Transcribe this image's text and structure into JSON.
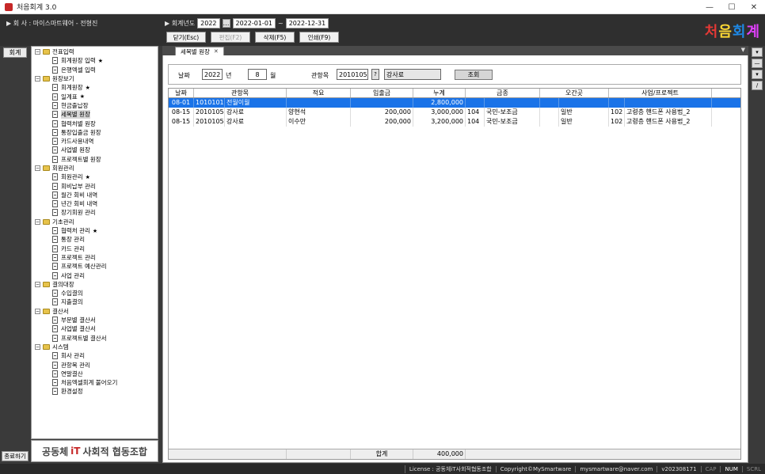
{
  "window": {
    "title": "처음회계 3.0",
    "minimize": "—",
    "maximize": "☐",
    "close": "✕"
  },
  "header": {
    "company_label": "▶ 회  사 : 마이스마트웨어 - 전형진",
    "fiscal_year_label": "▶ 회계년도",
    "fiscal_year": "2022",
    "dots": "…",
    "date_from": "2022-01-01",
    "tilde": "~",
    "date_to": "2022-12-31",
    "logo": "처음회계",
    "logo_colors": [
      "#e53935",
      "#fdd835",
      "#1e88e5",
      "#e040fb"
    ]
  },
  "toolbar": {
    "close_label": "닫기(Esc)",
    "edit_label": "편집(F2)",
    "delete_label": "삭제(F5)",
    "print_label": "인쇄(F9)"
  },
  "leftbar": {
    "tab_label": "회계",
    "bottom_label": "종료하기"
  },
  "tree": [
    {
      "type": "group",
      "label": "전표입력"
    },
    {
      "type": "leaf",
      "label": "회계원장 입력",
      "star": "★"
    },
    {
      "type": "leaf",
      "label": "은행엑셀 입력"
    },
    {
      "type": "group",
      "label": "원장보기"
    },
    {
      "type": "leaf",
      "label": "회계원장",
      "star": "★"
    },
    {
      "type": "leaf",
      "label": "일계표",
      "star": "★"
    },
    {
      "type": "leaf",
      "label": "현금출납장"
    },
    {
      "type": "leaf",
      "label": "세목별 원장",
      "selected": true
    },
    {
      "type": "leaf",
      "label": "협력처별 원장"
    },
    {
      "type": "leaf",
      "label": "통장입출금 원장"
    },
    {
      "type": "leaf",
      "label": "카드사용내역"
    },
    {
      "type": "leaf",
      "label": "사업별 원장"
    },
    {
      "type": "leaf",
      "label": "프로젝트별 원장"
    },
    {
      "type": "group",
      "label": "회원관리"
    },
    {
      "type": "leaf",
      "label": "회원관리",
      "star": "★"
    },
    {
      "type": "leaf",
      "label": "회비납부 관리"
    },
    {
      "type": "leaf",
      "label": "월간 회비 내역"
    },
    {
      "type": "leaf",
      "label": "년간 회비 내역"
    },
    {
      "type": "leaf",
      "label": "장기회원 관리"
    },
    {
      "type": "group",
      "label": "기초관리"
    },
    {
      "type": "leaf",
      "label": "협력처 관리",
      "star": "★"
    },
    {
      "type": "leaf",
      "label": "통장 관리"
    },
    {
      "type": "leaf",
      "label": "카드 관리"
    },
    {
      "type": "leaf",
      "label": "프로젝트 관리"
    },
    {
      "type": "leaf",
      "label": "프로젝트 예산관리"
    },
    {
      "type": "leaf",
      "label": "사업 관리"
    },
    {
      "type": "group",
      "label": "결의대장"
    },
    {
      "type": "leaf",
      "label": "수입결의"
    },
    {
      "type": "leaf",
      "label": "지출결의"
    },
    {
      "type": "group",
      "label": "결산서"
    },
    {
      "type": "leaf",
      "label": "부문별 결산서"
    },
    {
      "type": "leaf",
      "label": "사업별 결산서"
    },
    {
      "type": "leaf",
      "label": "프로젝트별 결산서"
    },
    {
      "type": "group",
      "label": "시스템"
    },
    {
      "type": "leaf",
      "label": "회사 관리"
    },
    {
      "type": "leaf",
      "label": "관항목 관리"
    },
    {
      "type": "leaf",
      "label": "연말결산"
    },
    {
      "type": "leaf",
      "label": "처음엑셀회계 불어오기"
    },
    {
      "type": "leaf",
      "label": "환경설정"
    }
  ],
  "footer_logo": {
    "prefix": "공동체",
    "it": "iT",
    "suffix": "사회적 협동조합"
  },
  "tab": {
    "label": "세목별 원장",
    "close": "✕"
  },
  "filter": {
    "date_label": "날짜",
    "year": "2022",
    "year_unit": "년",
    "month": "8",
    "month_unit": "월",
    "account_label": "관항목",
    "account_code": "2010105",
    "lookup": "?",
    "account_name": "강사료",
    "search_label": "조회"
  },
  "grid": {
    "columns": [
      "날짜",
      "관항목",
      "적요",
      "입출금",
      "누계",
      "금종",
      "오간곳",
      "사업/프로젝트"
    ],
    "rows": [
      {
        "date": "08-01",
        "code": "1010101",
        "account": "전월이월",
        "memo": "",
        "amount": "",
        "cumul": "2,800,000",
        "fund_code": "",
        "fund": "",
        "flag": "",
        "dest": "",
        "proj_code": "",
        "project": "",
        "selected": true
      },
      {
        "date": "08-15",
        "code": "2010105",
        "account": "강사료",
        "memo": "양현석",
        "amount": "200,000",
        "cumul": "3,000,000",
        "fund_code": "104",
        "fund": "국민-보조금",
        "flag": "",
        "dest": "일반",
        "proj_code": "102",
        "project": "고령층 핸드폰 사용법_2"
      },
      {
        "date": "08-15",
        "code": "2010105",
        "account": "강사료",
        "memo": "이수만",
        "amount": "200,000",
        "cumul": "3,200,000",
        "fund_code": "104",
        "fund": "국민-보조금",
        "flag": "",
        "dest": "일반",
        "proj_code": "102",
        "project": "고령층 핸드폰 사용법_2"
      }
    ],
    "total_label": "합계",
    "total_amount": "400,000"
  },
  "status": {
    "license": "License : 공동체iT사회적협동조합",
    "copyright": "Copyright©MySmartware",
    "email": "mysmartware@naver.com",
    "version": "v202308171",
    "cap": "CAP",
    "num": "NUM",
    "scrl": "SCRL"
  }
}
